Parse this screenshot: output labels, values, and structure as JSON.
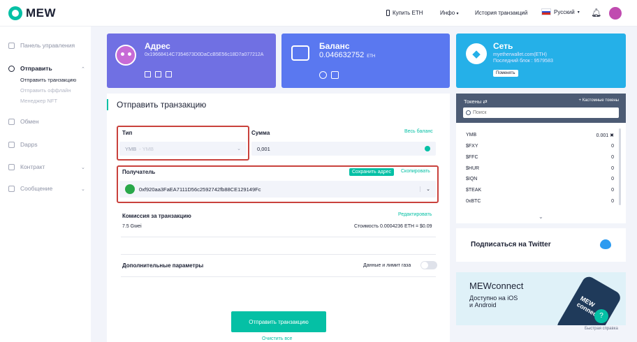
{
  "header": {
    "logo": "MEW",
    "buy_eth": "Купить ETH",
    "info": "Инфо",
    "history": "История транзакций",
    "language": "Русский"
  },
  "sidebar": {
    "dashboard": "Панель управления",
    "send": "Отправить",
    "send_sub": [
      "Отправить транзакцию",
      "Отправить оффлайн",
      "Менеджер NFT"
    ],
    "swap": "Обмен",
    "dapps": "Dapps",
    "contract": "Контракт",
    "message": "Сообщение"
  },
  "cards": {
    "address": {
      "title": "Адрес",
      "value": "0x19668414C7354673D0DaCcB5E56c18D7a077212A"
    },
    "balance": {
      "title": "Баланс",
      "value": "0.046632752",
      "unit": "ETH"
    },
    "network": {
      "title": "Сеть",
      "node": "myetherwallet.com(ETH)",
      "last_block": "Последний блок : 9579583",
      "change": "Поменять"
    }
  },
  "form": {
    "title": "Отправить транзакцию",
    "type_label": "Тип",
    "type_value": "YMB",
    "type_value_sub": "- YMB",
    "amount_label": "Сумма",
    "entire_balance": "Весь баланс",
    "amount_value": "0,001",
    "recipient_label": "Получатель",
    "save_address": "Сохранить адрес",
    "copy": "Скопировать",
    "recipient_value": "0xf920aa3FaEA7111D56c2592742fb88CE129149Fc",
    "fee_label": "Комиссия за транзакцию",
    "edit": "Редактировать",
    "gas_price": "7.5 Gwei",
    "fee_cost": "Стоимость 0.0004236 ETH = $0.09",
    "advanced_label": "Дополнительные параметры",
    "data_gas": "Данные и лимит газа",
    "send_button": "Отправить транзакцию",
    "clear_all": "Очистить все"
  },
  "tokens": {
    "title": "Токены",
    "custom": "+ Кастомные токены",
    "search_placeholder": "Поиск",
    "rows": [
      {
        "name": "YMB",
        "value": "0.001"
      },
      {
        "name": "$FXY",
        "value": "0"
      },
      {
        "name": "$FFC",
        "value": "0"
      },
      {
        "name": "$HUR",
        "value": "0"
      },
      {
        "name": "$IQN",
        "value": "0"
      },
      {
        "name": "$TEAK",
        "value": "0"
      },
      {
        "name": "0xBTC",
        "value": "0"
      }
    ]
  },
  "twitter": {
    "title": "Подписаться на Twitter"
  },
  "mewconnect": {
    "title": "MEWconnect",
    "line1": "Доступно на iOS",
    "line2": "и Android",
    "phone_text": "MEW connect"
  },
  "help": {
    "icon": "?",
    "label": "Быстрая справка"
  },
  "colors": {
    "brand": "#05c0a5",
    "address_card": "#7070e3",
    "balance_card": "#5a78f0",
    "network_card": "#25b0e8",
    "highlight_frame": "#c9413c"
  }
}
